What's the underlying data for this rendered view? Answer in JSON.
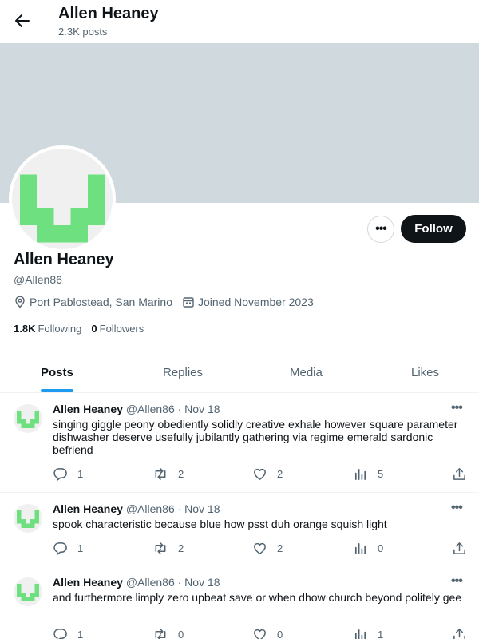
{
  "header": {
    "title": "Allen Heaney",
    "subtitle": "2.3K posts"
  },
  "profile": {
    "name": "Allen Heaney",
    "handle": "@Allen86",
    "location": "Port Pablostead, San Marino",
    "joined": "Joined November 2023",
    "following_count": "1.8K",
    "following_label": "Following",
    "followers_count": "0",
    "followers_label": "Followers",
    "follow_label": "Follow",
    "more_label": "•••"
  },
  "tabs": [
    {
      "label": "Posts"
    },
    {
      "label": "Replies"
    },
    {
      "label": "Media"
    },
    {
      "label": "Likes"
    }
  ],
  "posts": [
    {
      "name": "Allen Heaney",
      "handle": "@Allen86 · Nov 18",
      "text": "singing giggle peony obediently solidly creative exhale however square parameter dishwasher deserve usefully jubilantly gathering via regime emerald sardonic befriend",
      "replies": "1",
      "reposts": "2",
      "likes": "2",
      "views": "5"
    },
    {
      "name": "Allen Heaney",
      "handle": "@Allen86 · Nov 18",
      "text": "spook characteristic because blue how psst duh orange squish light",
      "replies": "1",
      "reposts": "2",
      "likes": "2",
      "views": "0"
    },
    {
      "name": "Allen Heaney",
      "handle": "@Allen86 · Nov 18",
      "text": "and furthermore limply zero upbeat save or when dhow church beyond politely gee",
      "replies": "1",
      "reposts": "0",
      "likes": "0",
      "views": "1"
    }
  ],
  "colors": {
    "accent": "#1d9bf0",
    "avatar_green": "#6ee07f",
    "banner": "#cfd9de",
    "follow_bg": "#0f1419"
  },
  "icons": [
    "back-arrow-icon",
    "location-pin-icon",
    "calendar-icon",
    "reply-icon",
    "repost-icon",
    "like-icon",
    "views-icon",
    "share-icon",
    "more-dots-icon"
  ]
}
